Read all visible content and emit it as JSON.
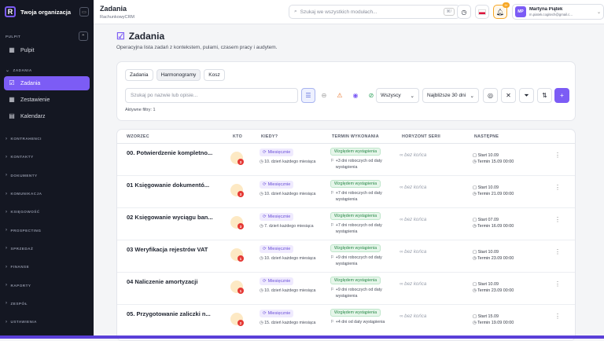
{
  "org": "Twoja organizacja",
  "sidebar": {
    "sec_pulpit": "PULPIT",
    "pulpit": "Pulpit",
    "sec_zadania": "ZADANIA",
    "zadania": "Zadania",
    "zestawienie": "Zestawienie",
    "kalendarz": "Kalendarz",
    "groups": [
      "KONTRAHENCI",
      "KONTAKTY",
      "DOKUMENTY",
      "KOMUNIKACJA",
      "KSIĘGOWOŚĆ",
      "PROSPECTING",
      "SPRZEDAŻ",
      "FINANSE",
      "RAPORTY",
      "ZESPÓŁ",
      "USTAWIENIA"
    ]
  },
  "top": {
    "title": "Zadania",
    "subtitle": "RachunkowyCRM",
    "search_placeholder": "Szukaj we wszystkich modułach...",
    "kbd": "⌘/",
    "bell_count": "9+",
    "user_initials": "MP",
    "user_name": "Martyna Piątek",
    "user_email": "m.piatek.cogitech@gmail.c..."
  },
  "page": {
    "title": "Zadania",
    "description": "Operacyjna lista zadań z kontekstem, pulami, czasem pracy i audytem."
  },
  "tabs": [
    "Zadania",
    "Harmonogramy",
    "Kosz"
  ],
  "filters": {
    "search_placeholder": "Szukaj po nazwie lub opisie...",
    "who": "Wszyscy",
    "range": "Najbliższe 30 dni",
    "active": "Aktywne filtry: 1"
  },
  "columns": [
    "WZORZEC",
    "KTO",
    "KIEDY?",
    "TERMIN WYKONANIA",
    "HORYZONT SERII",
    "NASTĘPNE"
  ],
  "rows": [
    {
      "name": "00. Potwierdzenie kompletno...",
      "badge": "3",
      "freq": "Miesięcznie",
      "day": "10. dzień każdego miesiąca",
      "due_tag": "Względem wystąpienia",
      "due": "+3 dni roboczych od daty wystąpienia",
      "horizon": "bez końca",
      "start": "Start 10.09",
      "termin": "Termin 15.09 00:00"
    },
    {
      "name": "01 Księgowanie dokumentó...",
      "badge": "3",
      "freq": "Miesięcznie",
      "day": "10. dzień każdego miesiąca",
      "due_tag": "Względem wystąpienia",
      "due": "+7 dni roboczych od daty wystąpienia",
      "horizon": "bez końca",
      "start": "Start 10.09",
      "termin": "Termin 21.09 00:00"
    },
    {
      "name": "02 Księgowanie wyciągu ban...",
      "badge": "3",
      "freq": "Miesięcznie",
      "day": "7. dzień każdego miesiąca",
      "due_tag": "Względem wystąpienia",
      "due": "+7 dni roboczych od daty wystąpienia",
      "horizon": "bez końca",
      "start": "Start 07.09",
      "termin": "Termin 16.09 00:00"
    },
    {
      "name": "03 Weryfikacja rejestrów VAT",
      "badge": "1",
      "freq": "Miesięcznie",
      "day": "10. dzień każdego miesiąca",
      "due_tag": "Względem wystąpienia",
      "due": "+9 dni roboczych od daty wystąpienia",
      "horizon": "bez końca",
      "start": "Start 10.09",
      "termin": "Termin 23.09 00:00"
    },
    {
      "name": "04 Naliczenie amortyzacji",
      "badge": "1",
      "freq": "Miesięcznie",
      "day": "10. dzień każdego miesiąca",
      "due_tag": "Względem wystąpienia",
      "due": "+9 dni roboczych od daty wystąpienia",
      "horizon": "bez końca",
      "start": "Start 10.09",
      "termin": "Termin 23.09 00:00"
    },
    {
      "name": "05. Przygotowanie zaliczki n...",
      "badge": "2",
      "freq": "Miesięcznie",
      "day": "15. dzień każdego miesiąca",
      "due_tag": "Względem wystąpienia",
      "due": "+4 dni od daty wystąpienia",
      "horizon": "bez końca",
      "start": "Start 15.09",
      "termin": "Termin 19.09 00:00"
    }
  ],
  "colors": {
    "accent": "#7c5cf5",
    "sidebar": "#141722"
  }
}
